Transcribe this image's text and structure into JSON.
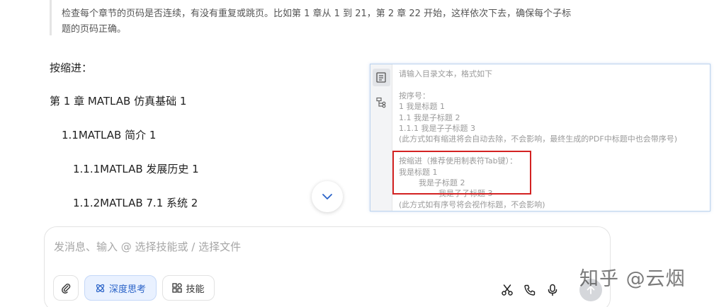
{
  "quote": {
    "line1": "检查每个章节的页码是否连续，有没有重复或跳页。比如第 1 章从 1 到 21，第 2 章 22 开始，这样依次下去，确保每个子标",
    "line2": "题的页码正确。"
  },
  "content": {
    "heading": "按缩进：",
    "items": [
      "第 1 章 MATLAB 仿真基础 1",
      "1.1MATLAB 简介 1",
      "1.1.1MATLAB 发展历史 1",
      "1.1.2MATLAB 7.1 系统 2"
    ]
  },
  "panel": {
    "lines": [
      "请输入目录文本，格式如下",
      "",
      "按序号：",
      "1  我是标题  1",
      "1.1  我是子标题  2",
      "1.1.1  我是子子标题 3",
      "(此方式如有缩进将会自动去除，不会影响，最终生成的PDF中标题中也会带序号)",
      "",
      "按缩进（推荐使用制表符Tab键）：",
      "我是标题  1",
      "我是子标题  2",
      "我是子子标题  3",
      "(此方式如有序号将会视作标题，不会影响)"
    ]
  },
  "composer": {
    "placeholder": "发消息、输入 @ 选择技能或 / 选择文件",
    "deep_think_label": "深度思考",
    "skill_label": "技能"
  },
  "watermark": "知乎 @云烟",
  "colors": {
    "accent": "#2a63c8",
    "highlight_border": "#d32222"
  }
}
